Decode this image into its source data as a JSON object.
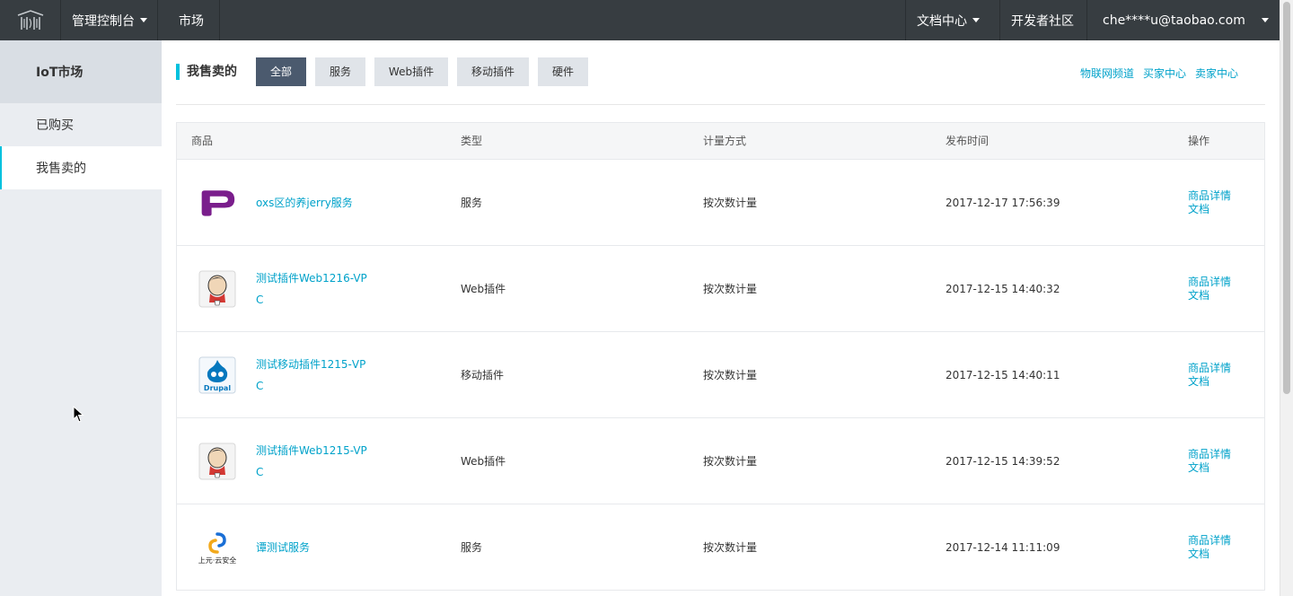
{
  "topbar": {
    "console": "管理控制台",
    "market": "市场",
    "docs": "文档中心",
    "community": "开发者社区",
    "user": "che****u@taobao.com"
  },
  "sidebar": {
    "title": "IoT市场",
    "items": [
      "已购买",
      "我售卖的"
    ]
  },
  "main": {
    "title": "我售卖的",
    "tabs": [
      "全部",
      "服务",
      "Web插件",
      "移动插件",
      "硬件"
    ],
    "links": [
      "物联网频道",
      "买家中心",
      "卖家中心"
    ]
  },
  "table": {
    "headers": [
      "商品",
      "类型",
      "计量方式",
      "发布时间",
      "操作"
    ],
    "rows": [
      {
        "name": "oxs区的养jerry服务",
        "type": "服务",
        "billing": "按次数计量",
        "time": "2017-12-17 17:56:39",
        "op1": "商品详情",
        "op2": "文档"
      },
      {
        "name": "测试插件Web1216-VPC",
        "type": "Web插件",
        "billing": "按次数计量",
        "time": "2017-12-15 14:40:32",
        "op1": "商品详情",
        "op2": "文档"
      },
      {
        "name": "测试移动插件1215-VPC",
        "type": "移动插件",
        "billing": "按次数计量",
        "time": "2017-12-15 14:40:11",
        "op1": "商品详情",
        "op2": "文档"
      },
      {
        "name": "测试插件Web1215-VPC",
        "type": "Web插件",
        "billing": "按次数计量",
        "time": "2017-12-15 14:39:52",
        "op1": "商品详情",
        "op2": "文档"
      },
      {
        "name": "谭测试服务",
        "type": "服务",
        "billing": "按次数计量",
        "time": "2017-12-14 11:11:09",
        "op1": "商品详情",
        "op2": "文档"
      }
    ]
  },
  "logos": {
    "drupal": "Drupal",
    "shangyuan": "上元·云安全"
  },
  "colors": {
    "accent": "#00c1de",
    "link": "#00a2ca",
    "topbar": "#373d41",
    "active_tab": "#4b5a6e"
  }
}
